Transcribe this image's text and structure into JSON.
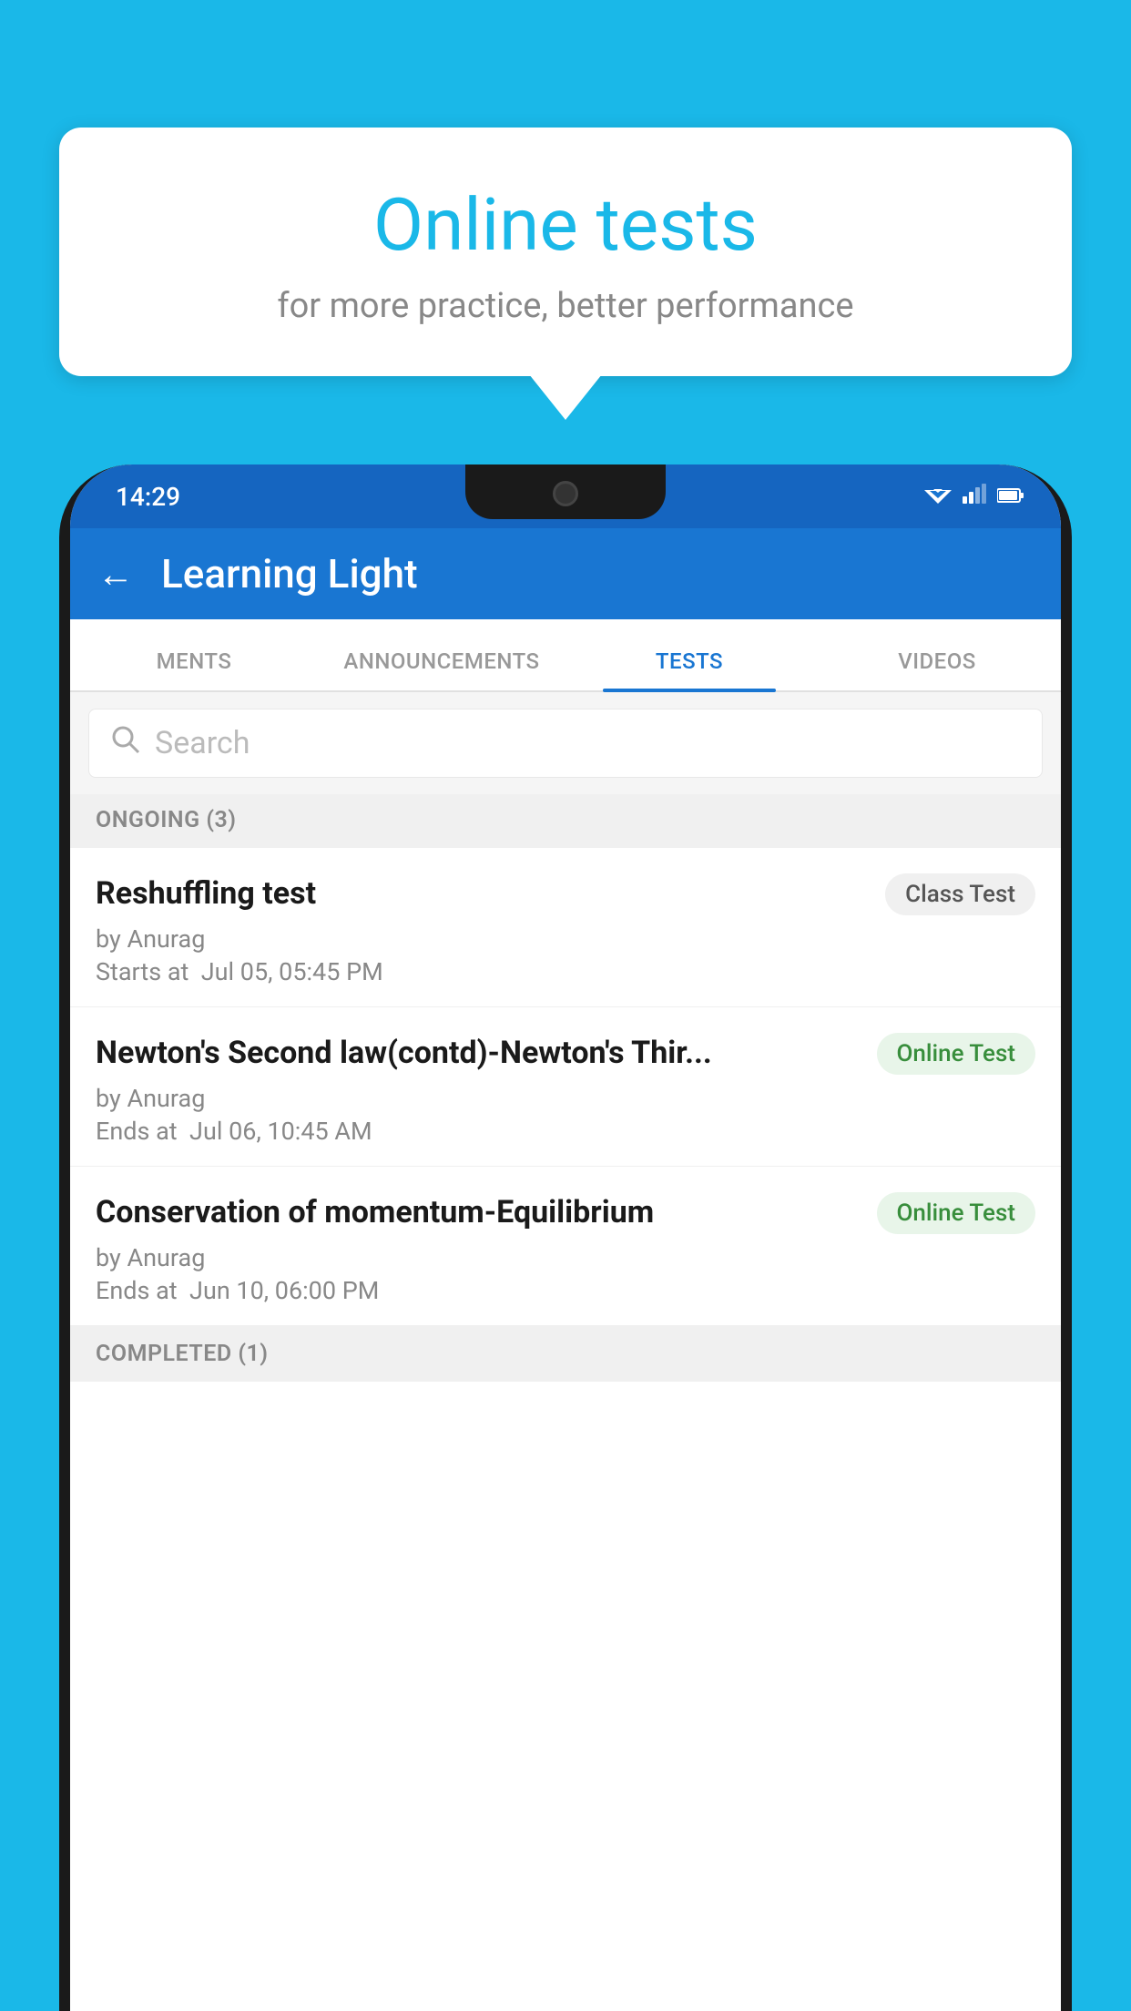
{
  "background_color": "#1ab8e8",
  "bubble": {
    "title": "Online tests",
    "subtitle": "for more practice, better performance"
  },
  "phone": {
    "status_bar": {
      "time": "14:29",
      "wifi": "▼",
      "signal": "▲",
      "battery": "▮"
    },
    "app_bar": {
      "back_label": "←",
      "title": "Learning Light"
    },
    "tabs": [
      {
        "label": "MENTS",
        "active": false
      },
      {
        "label": "ANNOUNCEMENTS",
        "active": false
      },
      {
        "label": "TESTS",
        "active": true
      },
      {
        "label": "VIDEOS",
        "active": false
      }
    ],
    "search": {
      "placeholder": "Search"
    },
    "sections": [
      {
        "header": "ONGOING (3)",
        "items": [
          {
            "name": "Reshuffling test",
            "badge": "Class Test",
            "badge_type": "class",
            "by": "by Anurag",
            "time_label": "Starts at",
            "time": "Jul 05, 05:45 PM"
          },
          {
            "name": "Newton's Second law(contd)-Newton's Thir...",
            "badge": "Online Test",
            "badge_type": "online",
            "by": "by Anurag",
            "time_label": "Ends at",
            "time": "Jul 06, 10:45 AM"
          },
          {
            "name": "Conservation of momentum-Equilibrium",
            "badge": "Online Test",
            "badge_type": "online",
            "by": "by Anurag",
            "time_label": "Ends at",
            "time": "Jun 10, 06:00 PM"
          }
        ]
      },
      {
        "header": "COMPLETED (1)",
        "items": []
      }
    ]
  }
}
